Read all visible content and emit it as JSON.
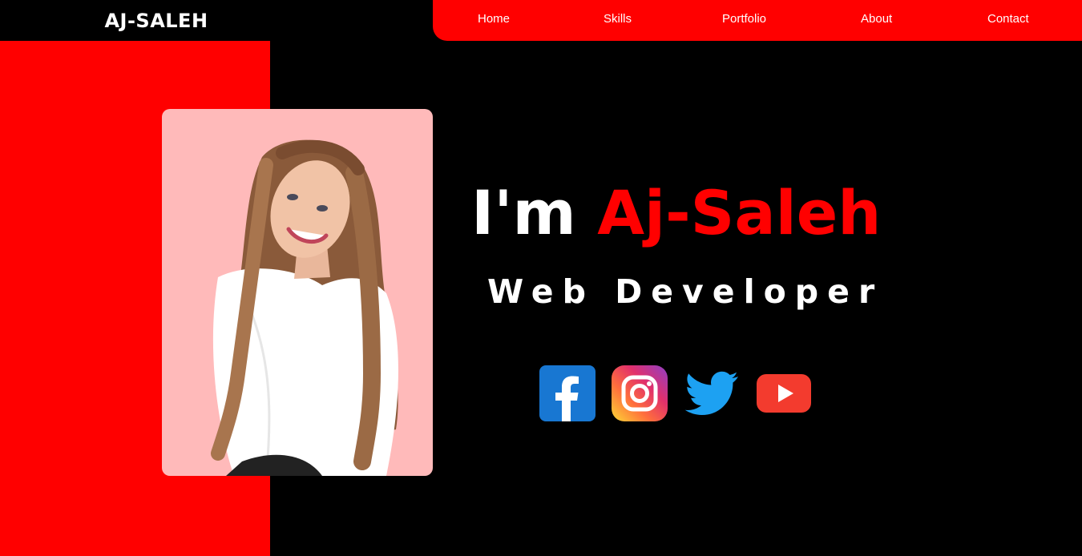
{
  "header": {
    "logo": "AJ-SALEH"
  },
  "nav": {
    "items": [
      {
        "label": "Home"
      },
      {
        "label": "Skills"
      },
      {
        "label": "Portfolio"
      },
      {
        "label": "About"
      },
      {
        "label": "Contact"
      }
    ]
  },
  "hero": {
    "greeting": "I'm",
    "name": "Aj-Saleh",
    "role": "Web Developer"
  },
  "social": {
    "icons": [
      "facebook-icon",
      "instagram-icon",
      "twitter-icon",
      "youtube-icon"
    ]
  },
  "colors": {
    "accent": "#ff0000",
    "background": "#000000",
    "photo_bg": "#ffbaba",
    "text": "#ffffff"
  }
}
